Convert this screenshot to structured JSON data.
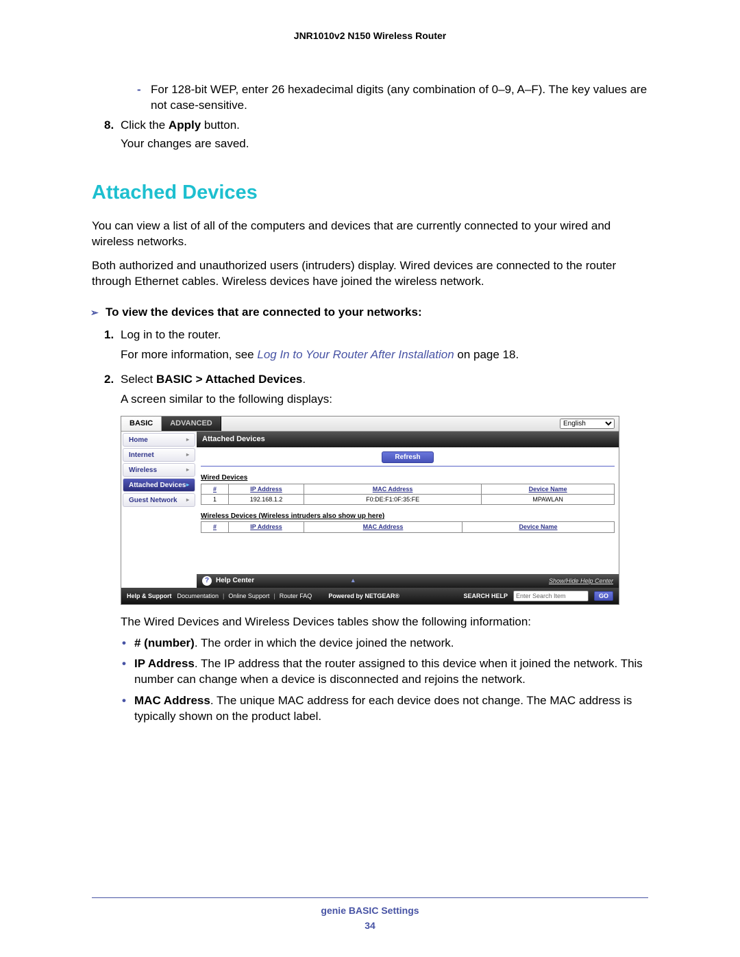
{
  "header": {
    "title": "JNR1010v2 N150 Wireless Router"
  },
  "intro": {
    "wep": "For 128-bit WEP, enter 26 hexadecimal digits (any combination of 0–9, A–F). The key values are not case-sensitive.",
    "step8_num": "8.",
    "step8_a": "Click the ",
    "step8_b": "Apply",
    "step8_c": " button.",
    "step8_res": "Your changes are saved."
  },
  "section": {
    "title": "Attached Devices"
  },
  "body": {
    "p1": "You can view a list of all of the computers and devices that are currently connected to your wired and wireless networks.",
    "p2": "Both authorized and unauthorized users (intruders) display. Wired devices are connected to the router through Ethernet cables. Wireless devices have joined the wireless network.",
    "proc": "To view the devices that are connected to your networks:",
    "s1_num": "1.",
    "s1": "Log in to the router.",
    "s1b_a": "For more information, see ",
    "s1b_link": "Log In to Your Router After Installation",
    "s1b_b": " on page 18.",
    "s2_num": "2.",
    "s2_a": "Select ",
    "s2_b": "BASIC > Attached Devices",
    "s2_c": ".",
    "s2_res": "A screen similar to the following displays:"
  },
  "fig": {
    "tab_basic": "BASIC",
    "tab_adv": "ADVANCED",
    "lang": "English",
    "side": [
      "Home",
      "Internet",
      "Wireless",
      "Attached Devices",
      "Guest Network"
    ],
    "title": "Attached Devices",
    "refresh": "Refresh",
    "wired_label": "Wired Devices",
    "wireless_label": "Wireless Devices (Wireless intruders also show up here)",
    "cols": {
      "n": "#",
      "ip": "IP Address",
      "mac": "MAC Address",
      "name": "Device Name"
    },
    "wired_rows": [
      {
        "n": "1",
        "ip": "192.168.1.2",
        "mac": "F0:DE:F1:0F:35:FE",
        "name": "MPAWLAN"
      }
    ],
    "help_center": "Help Center",
    "show_hide": "Show/Hide Help Center",
    "help_support": "Help & Support",
    "doc": "Documentation",
    "online": "Online Support",
    "faq": "Router FAQ",
    "powered": "Powered by NETGEAR®",
    "search_lbl": "SEARCH HELP",
    "search_ph": "Enter Search Item",
    "go": "GO"
  },
  "after": {
    "intro": "The Wired Devices and Wireless Devices tables show the following information:",
    "b1a": "# (number)",
    "b1b": ". The order in which the device joined the network.",
    "b2a": "IP Address",
    "b2b": ". The IP address that the router assigned to this device when it joined the network. This number can change when a device is disconnected and rejoins the network.",
    "b3a": "MAC Address",
    "b3b": ". The unique MAC address for each device does not change. The MAC address is typically shown on the product label."
  },
  "footer": {
    "section": "genie BASIC Settings",
    "page": "34"
  }
}
